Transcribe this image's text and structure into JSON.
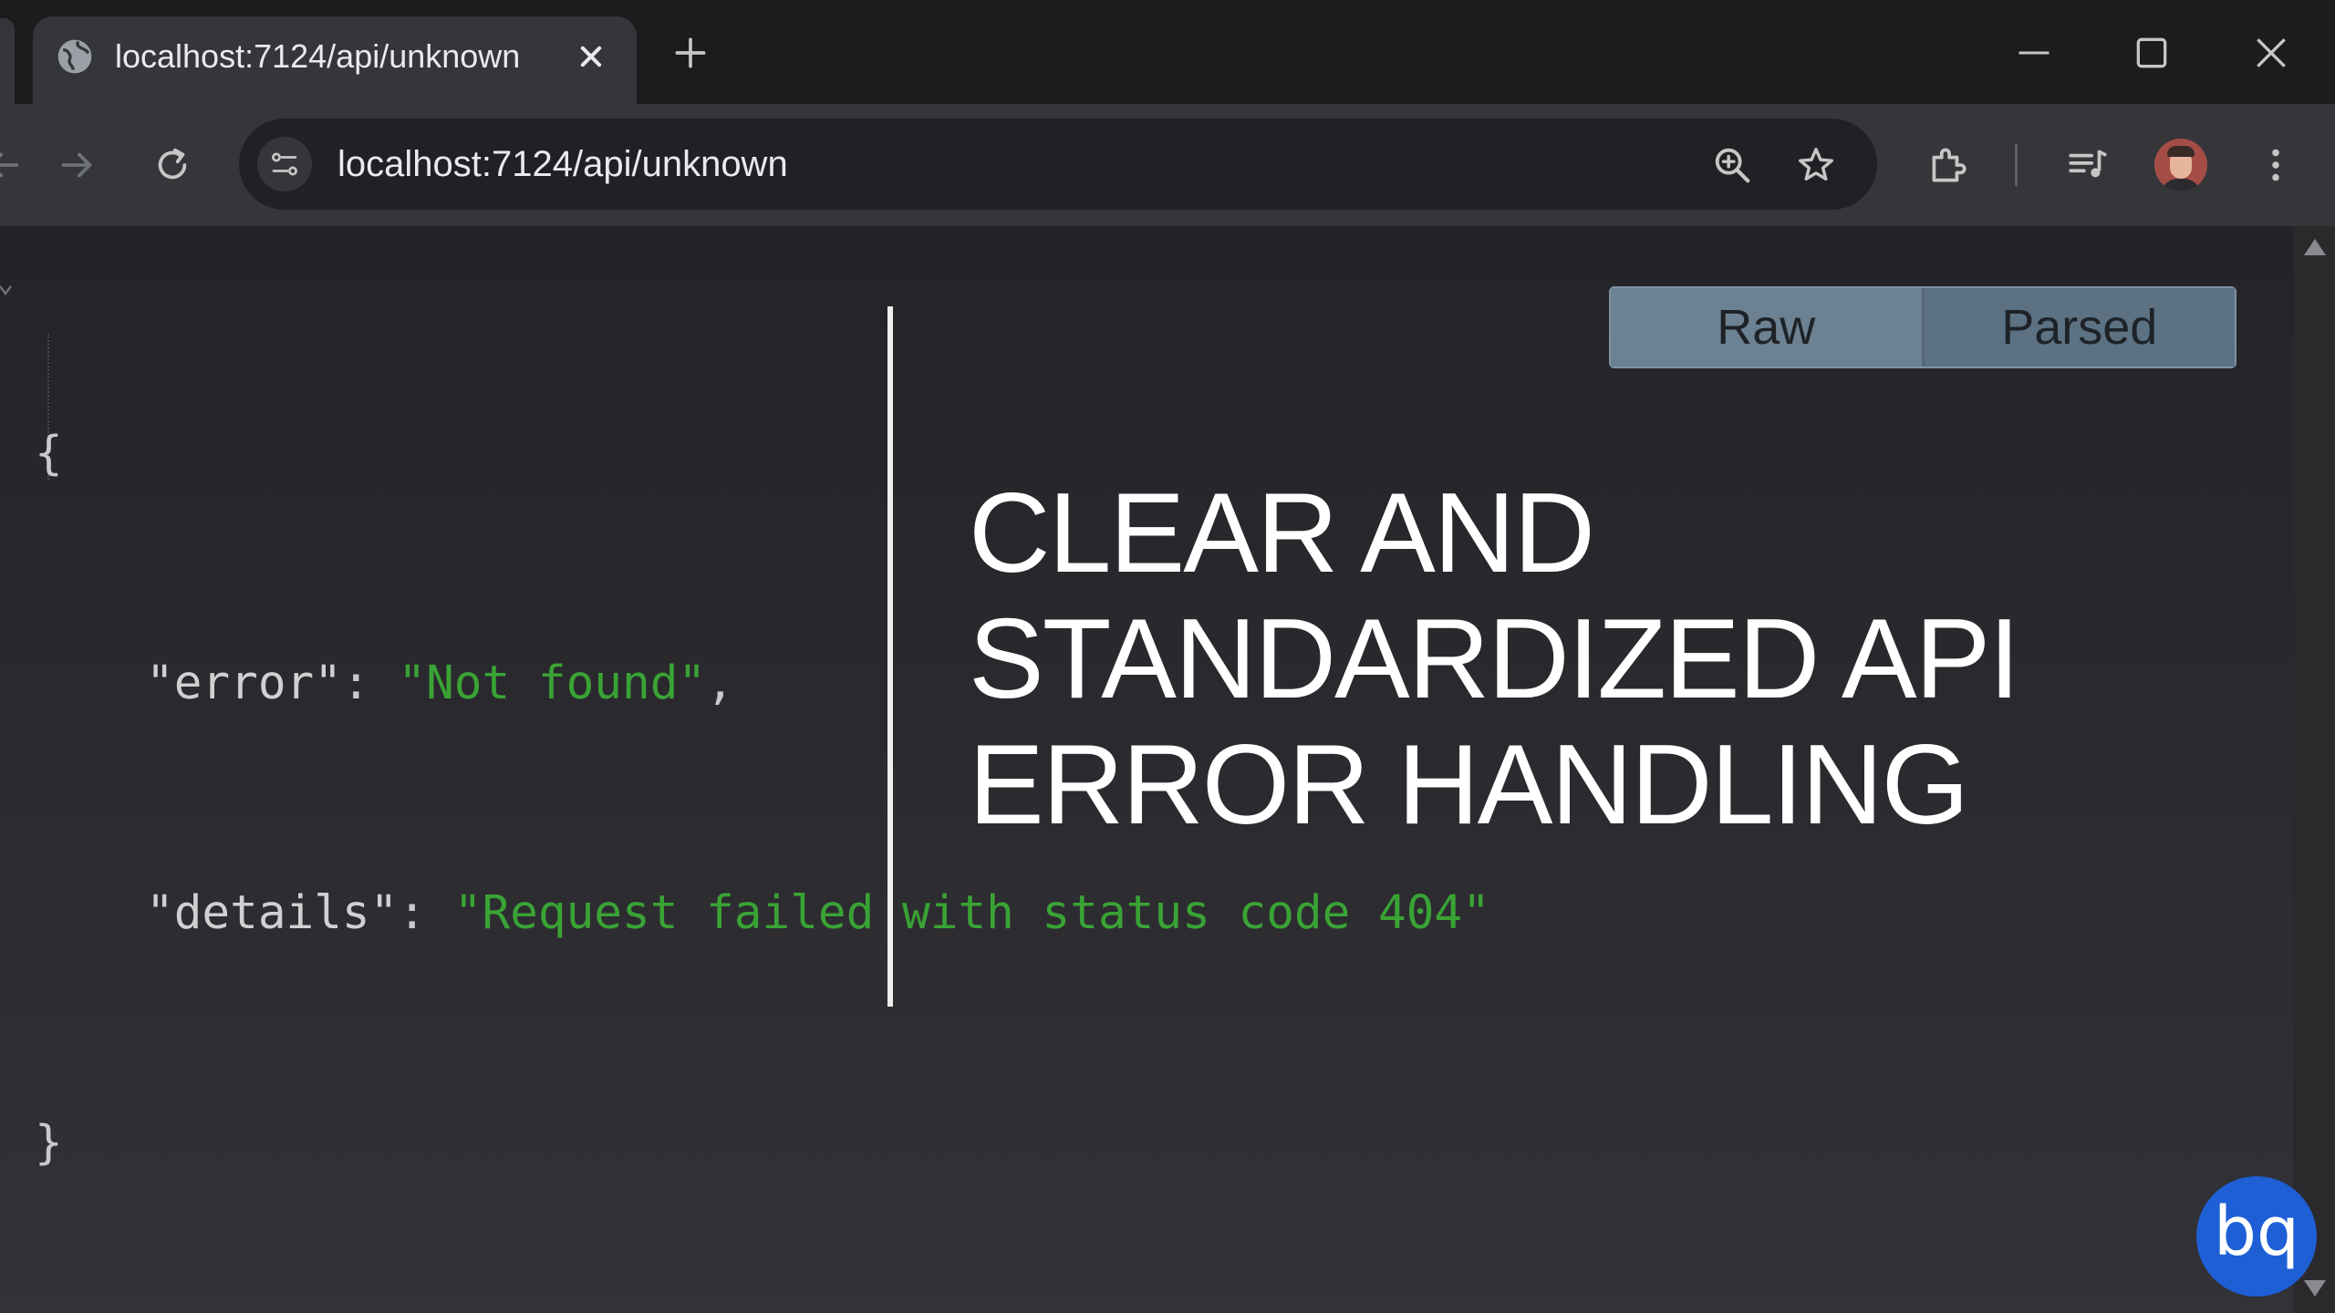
{
  "browser": {
    "tab": {
      "title": "localhost:7124/api/unknown",
      "favicon": "globe-icon"
    },
    "address_bar": {
      "url": "localhost:7124/api/unknown"
    }
  },
  "page": {
    "json": {
      "open_brace": "{",
      "close_brace": "}",
      "lines": [
        {
          "key": "\"error\"",
          "separator": ": ",
          "value": "\"Not found\"",
          "trailing": ","
        },
        {
          "key": "\"details\"",
          "separator": ": ",
          "value": "\"Request failed with status code 404\"",
          "trailing": ""
        }
      ]
    },
    "view_toggle": {
      "raw_label": "Raw",
      "parsed_label": "Parsed"
    }
  },
  "overlay": {
    "title_lines": [
      "CLEAR AND",
      "STANDARDIZED API",
      "ERROR HANDLING"
    ],
    "logo_text": "bq"
  },
  "colors": {
    "json_string": "#3aa335",
    "logo_background": "#1e5fd6",
    "toggle_background": "#6a8090"
  }
}
